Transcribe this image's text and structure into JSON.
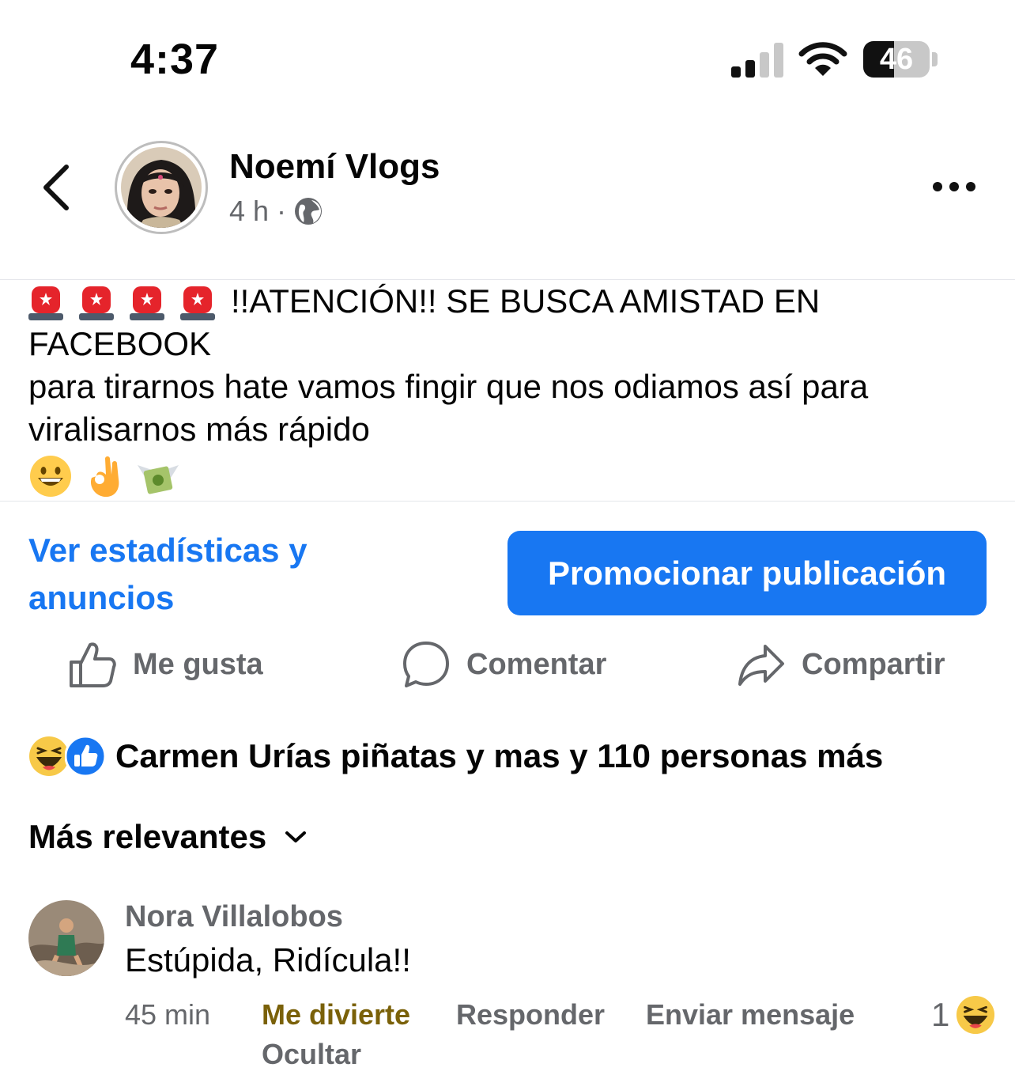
{
  "status_bar": {
    "time": "4:37",
    "battery": "46",
    "battery_level": 0.46
  },
  "header": {
    "page_name": "Noemí Vlogs",
    "time_ago": "4 h",
    "separator": "·",
    "privacy_icon": "globe-icon"
  },
  "post": {
    "headline": "!!ATENCIÓN!! SE BUSCA AMISTAD EN",
    "line2": "FACEBOOK",
    "line3": "para tirarnos hate vamos fingir que nos odiamos así para",
    "line4": "viralisarnos más rápido",
    "lead_emojis": [
      "police-light-icon",
      "police-light-icon",
      "police-light-icon",
      "police-light-icon"
    ],
    "trail_emojis": [
      "grinning-face-icon",
      "ok-hand-icon",
      "money-with-wings-icon"
    ]
  },
  "insights": {
    "stats_link": "Ver estadísticas y anuncios",
    "promote_button": "Promocionar publicación"
  },
  "actions": {
    "like": "Me gusta",
    "comment": "Comentar",
    "share": "Compartir"
  },
  "reactions": {
    "summary": "Carmen Urías piñatas y mas y 110 personas más",
    "icons": [
      "haha-icon",
      "like-icon"
    ]
  },
  "comments_sort": {
    "label": "Más relevantes"
  },
  "comments": [
    {
      "author": "Nora Villalobos",
      "text": "Estúpida, Ridícula!!",
      "time": "45 min",
      "reaction_label": "Me divierte",
      "reply_label": "Responder",
      "message_label": "Enviar mensaje",
      "hide_label": "Ocultar",
      "reaction_count": "1"
    }
  ],
  "colors": {
    "brand_blue": "#1877f2",
    "muted_text": "#65676b",
    "haha_gold": "#7a6109"
  }
}
